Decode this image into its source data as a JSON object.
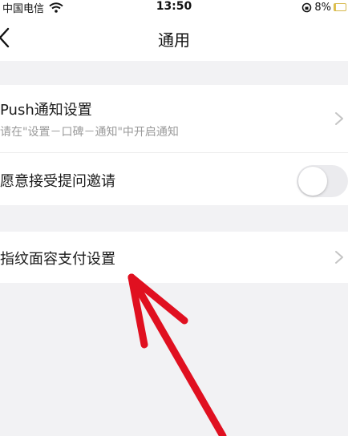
{
  "status_bar": {
    "carrier": "中国电信",
    "time": "13:50",
    "battery": "8%"
  },
  "nav": {
    "title": "通用",
    "back_icon": "chevron-left-icon"
  },
  "settings": {
    "push": {
      "title": "Push通知设置",
      "subtitle": "请在\"设置－口碑－通知\"中开启通知"
    },
    "invite": {
      "title": "愿意接受提问邀请",
      "toggle_on": false
    },
    "biometric_pay": {
      "title": "指纹面容支付设置"
    }
  },
  "colors": {
    "background": "#f2f2f4",
    "card": "#ffffff",
    "annotation_arrow": "#e01020"
  }
}
